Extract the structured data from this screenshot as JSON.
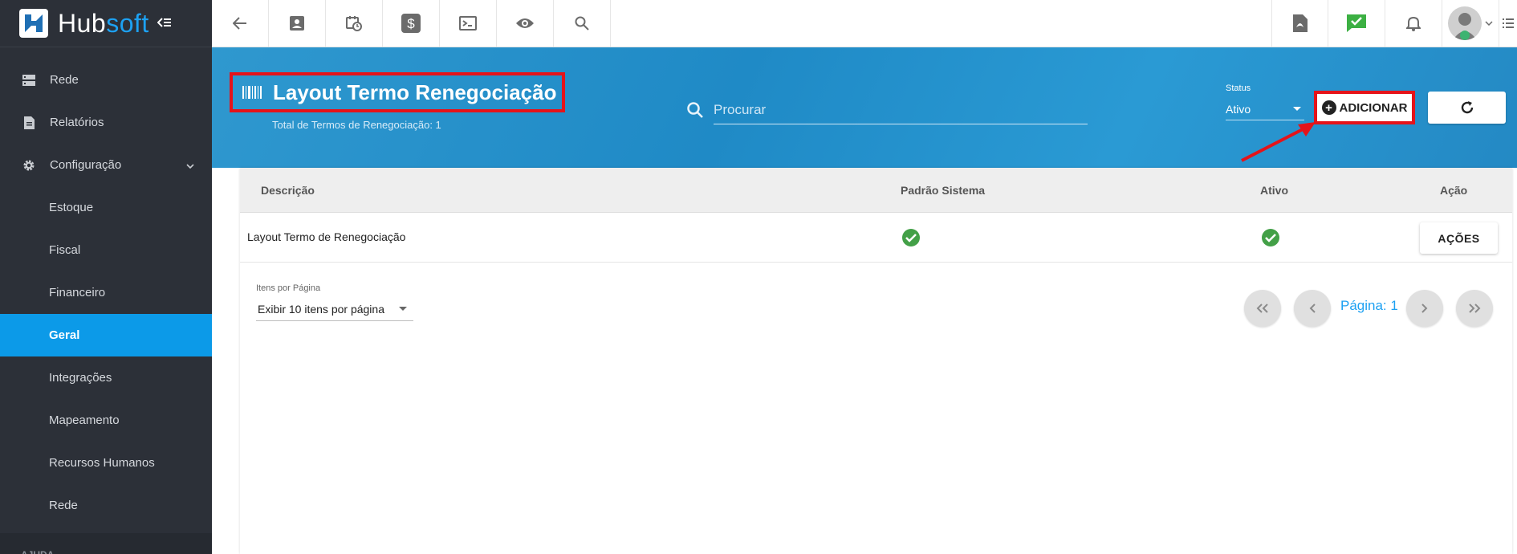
{
  "app": {
    "logo_main": "Hub",
    "logo_accent": "soft"
  },
  "sidebar": {
    "items": [
      {
        "label": "Rede",
        "icon": "server-icon"
      },
      {
        "label": "Relatórios",
        "icon": "document-icon"
      },
      {
        "label": "Configuração",
        "icon": "gear-icon"
      },
      {
        "label": "Estoque"
      },
      {
        "label": "Fiscal"
      },
      {
        "label": "Financeiro"
      },
      {
        "label": "Geral"
      },
      {
        "label": "Integrações"
      },
      {
        "label": "Mapeamento"
      },
      {
        "label": "Recursos Humanos"
      },
      {
        "label": "Rede"
      }
    ],
    "section_label": "AJUDA"
  },
  "header": {
    "title": "Layout Termo Renegociação",
    "subtitle": "Total de Termos de Renegociação: 1",
    "search_placeholder": "Procurar",
    "status_label": "Status",
    "status_value": "Ativo",
    "add_label": "ADICIONAR"
  },
  "table": {
    "columns": [
      "Descrição",
      "Padrão Sistema",
      "Ativo",
      "Ação"
    ],
    "rows": [
      {
        "descricao": "Layout Termo de Renegociação",
        "padrao": true,
        "ativo": true,
        "acao_label": "AÇÕES"
      }
    ]
  },
  "pagination": {
    "items_per_page_label": "Itens por Página",
    "items_per_page_value": "Exibir 10 itens por página",
    "page_label": "Página: 1"
  },
  "colors": {
    "sidebar_bg": "#2c3038",
    "active": "#0c9ae8",
    "banner": "#2189c4",
    "highlight": "#e5131a",
    "check": "#43a047"
  }
}
